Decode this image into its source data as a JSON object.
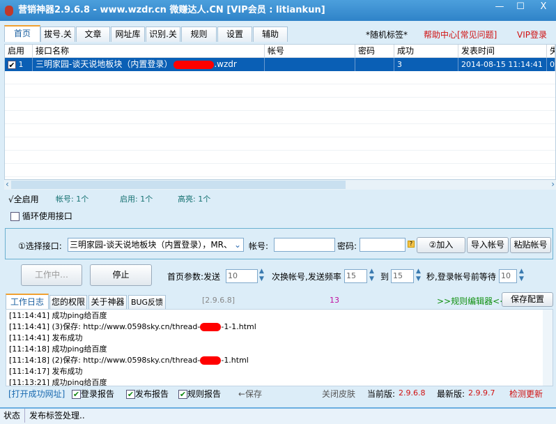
{
  "window": {
    "title": "营销神器2.9.6.8 - www.wzdr.cn 微赚达人.CN [VIP会员 : litiankun]",
    "minimize": "—",
    "maximize": "☐",
    "close": "X"
  },
  "tabs": [
    {
      "label": "首页"
    },
    {
      "label": "拔号.关"
    },
    {
      "label": "文章"
    },
    {
      "label": "网址库"
    },
    {
      "label": "识别.关"
    },
    {
      "label": "规则"
    },
    {
      "label": "设置"
    },
    {
      "label": "辅助"
    }
  ],
  "top_links": {
    "random_tag": "*随机标签*",
    "help": "帮助中心[常见问题]",
    "vip": "VIP登录"
  },
  "table": {
    "columns": [
      "启用",
      "接口名称",
      "帐号",
      "密码",
      "成功",
      "发表时间",
      "失"
    ],
    "rows": [
      {
        "enabled": true,
        "index": "1",
        "name": "三明家园-谈天说地板块（内置登录）",
        "name_suffix": ".wzdr",
        "account": "",
        "password": "",
        "success": "3",
        "time": "2014-08-15 11:14:41",
        "fail": "0"
      }
    ]
  },
  "stats": {
    "enable_all": "√全启用",
    "accounts": "帐号: 1个",
    "enabled": "启用: 1个",
    "highlight": "高亮: 1个"
  },
  "loop_label": "循环使用接口",
  "form": {
    "select_label": "①选择接口:",
    "select_value": "三明家园-谈天说地板块（内置登录），MR、",
    "account_label": "帐号:",
    "account_value": "",
    "password_label": "密码:",
    "password_value": "",
    "add": "②加入",
    "import": "导入帐号",
    "paste": "粘贴帐号"
  },
  "controls": {
    "working": "工作中…",
    "stop": "停止",
    "param_label": "首页参数:发送",
    "send_count": "10",
    "switch_label": "次换帐号,发送频率",
    "freq_from": "15",
    "to_label": "到",
    "freq_to": "15",
    "wait_label": "秒,登录帐号前等待",
    "wait": "10"
  },
  "log_tabs": [
    {
      "label": "工作日志"
    },
    {
      "label": "您的权限"
    },
    {
      "label": "关于神器"
    },
    {
      "label": "BUG反馈"
    }
  ],
  "version_tag": "[2.9.6.8]",
  "count": "13",
  "rule_editor": ">>规则编辑器<<",
  "save_config": "保存配置",
  "log": [
    {
      "text": "[11:14:41] 成功ping给百度"
    },
    {
      "text": "[11:14:41] (3)保存: http://www.0598sky.cn/thread-",
      "tail": "-1-1.html"
    },
    {
      "text": "[11:14:41] 发布成功"
    },
    {
      "text": "[11:14:18] 成功ping给百度"
    },
    {
      "text": "[11:14:18] (2)保存: http://www.0598sky.cn/thread-",
      "tail": "-1.html"
    },
    {
      "text": "[11:14:17] 发布成功"
    },
    {
      "text": "[11:13:21] 成功ping给百度"
    }
  ],
  "bottom": {
    "open_url": "[打开成功网址]",
    "login_report": "登录报告",
    "publish_report": "发布报告",
    "rule_report": "规则报告",
    "save": "←保存",
    "close_skin": "关闭皮肤",
    "current_label": "当前版:",
    "current": "2.9.6.8",
    "latest_label": "最新版:",
    "latest": "2.9.9.7",
    "check_update": "检测更新"
  },
  "status": {
    "label": "状态",
    "text": "发布标签处理.."
  }
}
